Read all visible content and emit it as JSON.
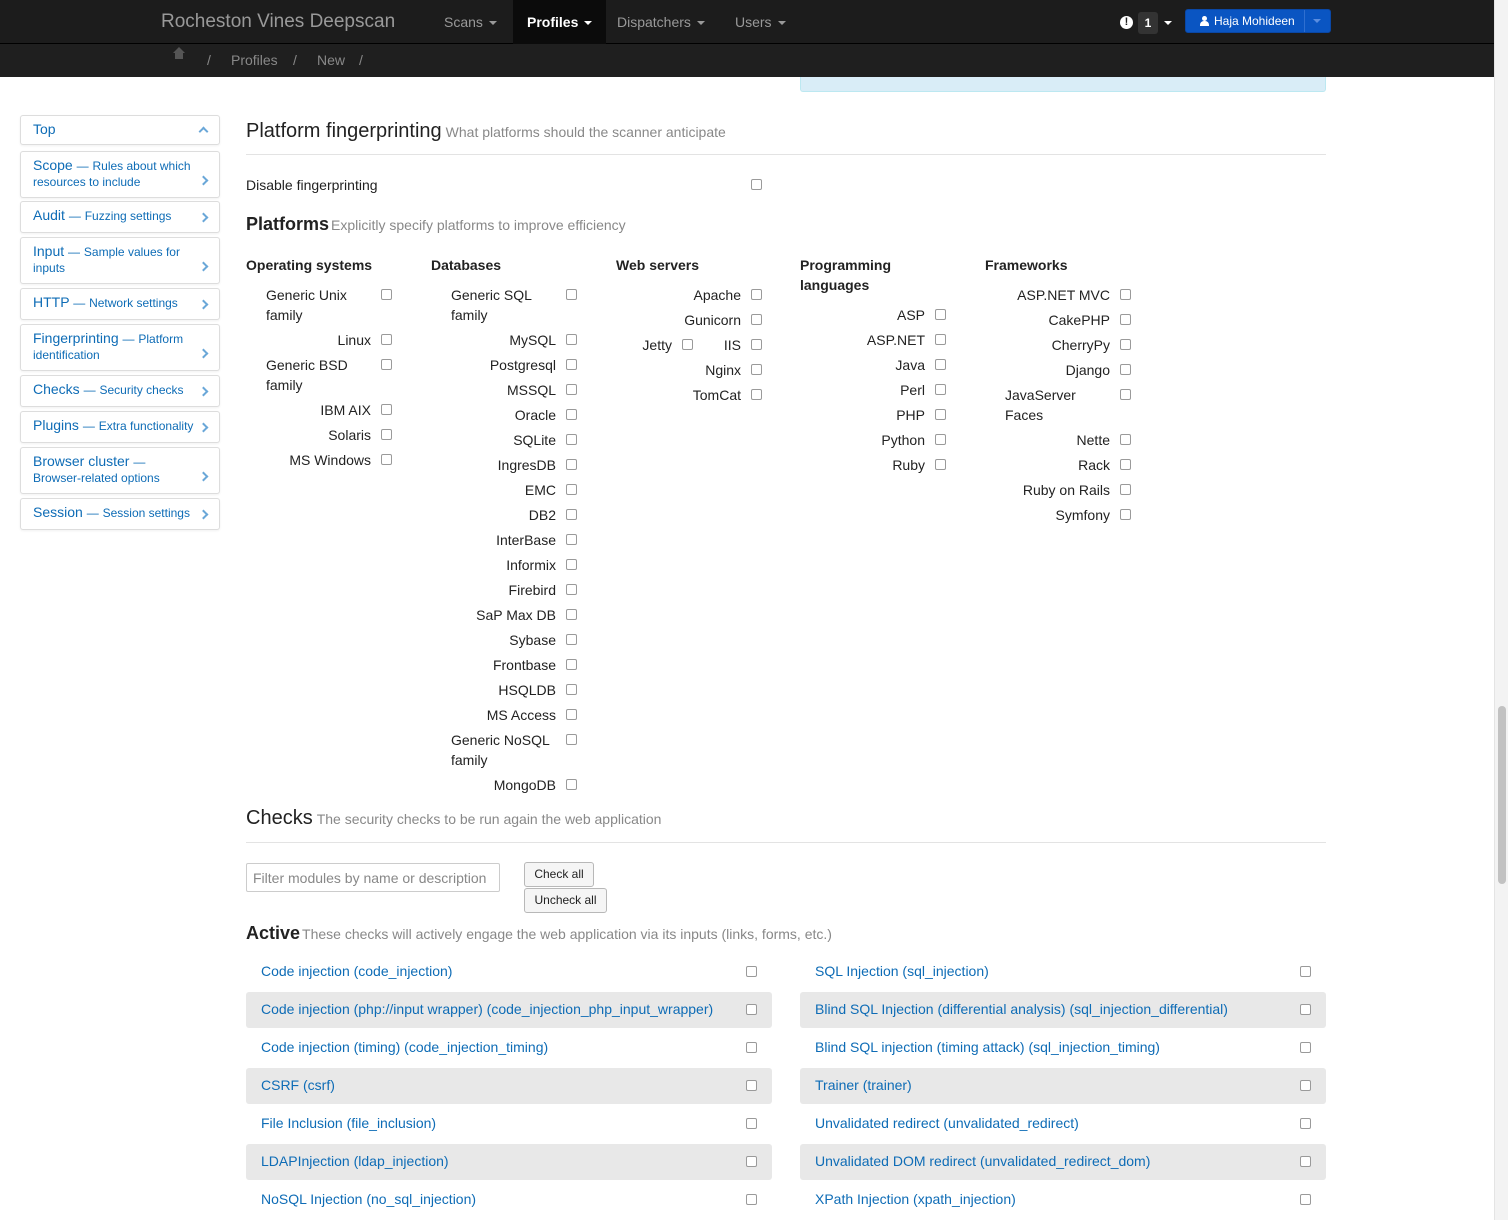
{
  "navbar": {
    "brand": "Rocheston Vines Deepscan",
    "items": [
      {
        "label": "Scans"
      },
      {
        "label": "Profiles"
      },
      {
        "label": "Dispatchers"
      },
      {
        "label": "Users"
      }
    ],
    "notification_count": "1",
    "user_name": "Haja Mohideen"
  },
  "breadcrumb": {
    "items": [
      "Profiles",
      "New"
    ],
    "separator": "/"
  },
  "sidebar": {
    "top_label": "Top",
    "items": [
      {
        "title": "Scope",
        "desc": "Rules about which resources to include"
      },
      {
        "title": "Audit",
        "desc": "Fuzzing settings"
      },
      {
        "title": "Input",
        "desc": "Sample values for inputs"
      },
      {
        "title": "HTTP",
        "desc": "Network settings"
      },
      {
        "title": "Fingerprinting",
        "desc": "Platform identification"
      },
      {
        "title": "Checks",
        "desc": "Security checks"
      },
      {
        "title": "Plugins",
        "desc": "Extra functionality"
      },
      {
        "title": "Browser cluster",
        "desc": "Browser-related options"
      },
      {
        "title": "Session",
        "desc": "Session settings"
      }
    ],
    "dash": "—"
  },
  "fingerprinting": {
    "title": "Platform fingerprinting",
    "subtitle": "What platforms should the scanner anticipate",
    "disable_label": "Disable fingerprinting"
  },
  "platforms": {
    "title": "Platforms",
    "subtitle": "Explicitly specify platforms to improve efficiency",
    "columns": [
      {
        "heading": "Operating systems",
        "items": [
          "Generic Unix family",
          "Linux",
          "Generic BSD family",
          "IBM AIX",
          "Solaris",
          "MS Windows"
        ]
      },
      {
        "heading": "Databases",
        "items": [
          "Generic SQL family",
          "MySQL",
          "Postgresql",
          "MSSQL",
          "Oracle",
          "SQLite",
          "IngresDB",
          "EMC",
          "DB2",
          "InterBase",
          "Informix",
          "Firebird",
          "SaP Max DB",
          "Sybase",
          "Frontbase",
          "HSQLDB",
          "MS Access",
          "Generic NoSQL family",
          "MongoDB"
        ]
      },
      {
        "heading": "Web servers",
        "items": [
          "Apache",
          "Gunicorn",
          "Jetty",
          "IIS",
          "Nginx",
          "TomCat"
        ]
      },
      {
        "heading": "Programming languages",
        "items": [
          "ASP",
          "ASP.NET",
          "Java",
          "Perl",
          "PHP",
          "Python",
          "Ruby"
        ]
      },
      {
        "heading": "Frameworks",
        "items": [
          "ASP.NET MVC",
          "CakePHP",
          "CherryPy",
          "Django",
          "JavaServer Faces",
          "Nette",
          "Rack",
          "Ruby on Rails",
          "Symfony"
        ]
      }
    ]
  },
  "checks": {
    "title": "Checks",
    "subtitle": "The security checks to be run again the web application",
    "filter_placeholder": "Filter modules by name or description",
    "check_all": "Check all",
    "uncheck_all": "Uncheck all",
    "active": {
      "title": "Active",
      "subtitle": "These checks will actively engage the web application via its inputs (links, forms, etc.)",
      "left": [
        "Code injection (code_injection)",
        "Code injection (php://input wrapper) (code_injection_php_input_wrapper)",
        "Code injection (timing) (code_injection_timing)",
        "CSRF (csrf)",
        "File Inclusion (file_inclusion)",
        "LDAPInjection (ldap_injection)",
        "NoSQL Injection (no_sql_injection)"
      ],
      "right": [
        "SQL Injection (sql_injection)",
        "Blind SQL Injection (differential analysis) (sql_injection_differential)",
        "Blind SQL injection (timing attack) (sql_injection_timing)",
        "Trainer (trainer)",
        "Unvalidated redirect (unvalidated_redirect)",
        "Unvalidated DOM redirect (unvalidated_redirect_dom)",
        "XPath Injection (xpath_injection)"
      ]
    }
  }
}
